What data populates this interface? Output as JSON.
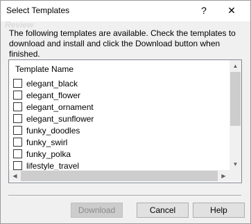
{
  "window": {
    "title": "Select Templates",
    "help_glyph": "?",
    "close_glyph": "✕"
  },
  "description": "The following templates are available.  Check the templates to download and install and click the Download button when finished.",
  "list": {
    "header": "Template Name",
    "items": [
      {
        "label": "elegant_black",
        "checked": false
      },
      {
        "label": "elegant_flower",
        "checked": false
      },
      {
        "label": "elegant_ornament",
        "checked": false
      },
      {
        "label": "elegant_sunflower",
        "checked": false
      },
      {
        "label": "funky_doodles",
        "checked": false
      },
      {
        "label": "funky_swirl",
        "checked": false
      },
      {
        "label": "funky_polka",
        "checked": false
      },
      {
        "label": "lifestyle_travel",
        "checked": false
      }
    ],
    "arrows": {
      "up": "▲",
      "down": "▼",
      "left": "◀",
      "right": "▶"
    }
  },
  "buttons": {
    "download": "Download",
    "cancel": "Cancel",
    "help": "Help"
  }
}
